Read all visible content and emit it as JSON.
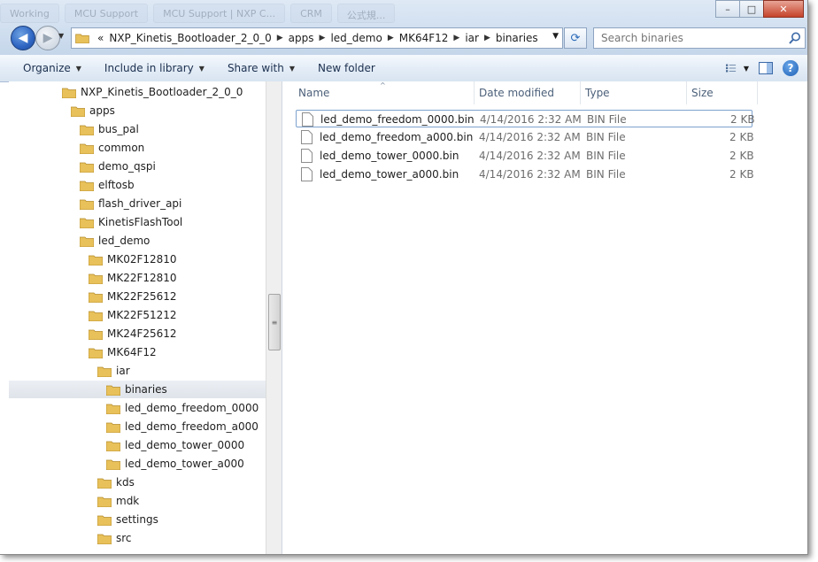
{
  "titlebar": {
    "background_tabs": [
      "Working",
      "MCU Support",
      "MCU Support | NXP C...",
      "CRM",
      "公式規..."
    ]
  },
  "window_controls": {
    "minimize": "–",
    "maximize": "□",
    "close": "✕"
  },
  "address": {
    "overflow": "«",
    "crumbs": [
      "NXP_Kinetis_Bootloader_2_0_0",
      "apps",
      "led_demo",
      "MK64F12",
      "iar",
      "binaries"
    ]
  },
  "search": {
    "placeholder": "Search binaries"
  },
  "toolbar": {
    "organize": "Organize",
    "include_in_library": "Include in library",
    "share_with": "Share with",
    "new_folder": "New folder"
  },
  "tree": [
    {
      "label": "NXP_Kinetis_Bootloader_2_0_0",
      "level": 0
    },
    {
      "label": "apps",
      "level": 1
    },
    {
      "label": "bus_pal",
      "level": 2
    },
    {
      "label": "common",
      "level": 2
    },
    {
      "label": "demo_qspi",
      "level": 2
    },
    {
      "label": "elftosb",
      "level": 2
    },
    {
      "label": "flash_driver_api",
      "level": 2
    },
    {
      "label": "KinetisFlashTool",
      "level": 2
    },
    {
      "label": "led_demo",
      "level": 2
    },
    {
      "label": "MK02F12810",
      "level": 3
    },
    {
      "label": "MK22F12810",
      "level": 3
    },
    {
      "label": "MK22F25612",
      "level": 3
    },
    {
      "label": "MK22F51212",
      "level": 3
    },
    {
      "label": "MK24F25612",
      "level": 3
    },
    {
      "label": "MK64F12",
      "level": 3
    },
    {
      "label": "iar",
      "level": 4
    },
    {
      "label": "binaries",
      "level": 5,
      "selected": true
    },
    {
      "label": "led_demo_freedom_0000",
      "level": 5
    },
    {
      "label": "led_demo_freedom_a000",
      "level": 5
    },
    {
      "label": "led_demo_tower_0000",
      "level": 5
    },
    {
      "label": "led_demo_tower_a000",
      "level": 5
    },
    {
      "label": "kds",
      "level": 4
    },
    {
      "label": "mdk",
      "level": 4
    },
    {
      "label": "settings",
      "level": 4
    },
    {
      "label": "src",
      "level": 4
    }
  ],
  "columns": {
    "name": "Name",
    "date": "Date modified",
    "type": "Type",
    "size": "Size"
  },
  "files": [
    {
      "name": "led_demo_freedom_0000.bin",
      "date": "4/14/2016 2:32 AM",
      "type": "BIN File",
      "size": "2 KB"
    },
    {
      "name": "led_demo_freedom_a000.bin",
      "date": "4/14/2016 2:32 AM",
      "type": "BIN File",
      "size": "2 KB"
    },
    {
      "name": "led_demo_tower_0000.bin",
      "date": "4/14/2016 2:32 AM",
      "type": "BIN File",
      "size": "2 KB"
    },
    {
      "name": "led_demo_tower_a000.bin",
      "date": "4/14/2016 2:32 AM",
      "type": "BIN File",
      "size": "2 KB"
    }
  ],
  "colors": {
    "folder": "#e8c15a",
    "selection": "#7da2ce",
    "chrome": "#cfdeef"
  }
}
